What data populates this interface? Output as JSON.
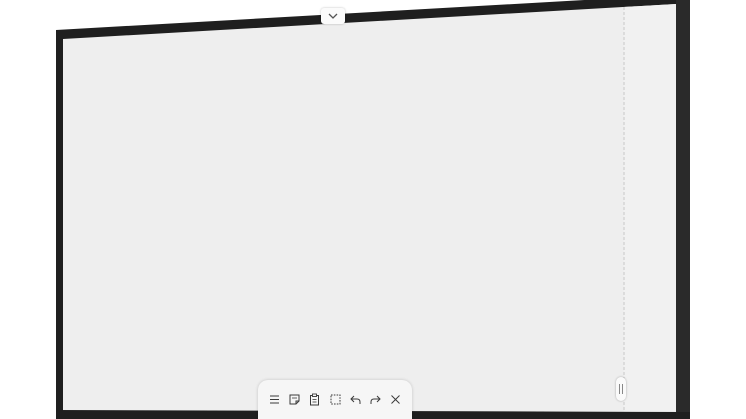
{
  "device": {
    "bezel_color": "#1f1f1f",
    "screen_color": "#eeeeee",
    "side_panel_color": "#f1f1f1",
    "divider_color": "#c8c8c8"
  },
  "top_handle": {
    "icon": "chevron-down-icon"
  },
  "toolbar": {
    "background": "#f6f6f6",
    "icon_color": "#3a3a3a",
    "tools": [
      {
        "icon": "menu-icon"
      },
      {
        "icon": "sticky-note-icon"
      },
      {
        "icon": "clipboard-icon"
      },
      {
        "icon": "selection-icon"
      },
      {
        "icon": "undo-icon"
      },
      {
        "icon": "redo-icon"
      },
      {
        "icon": "close-icon"
      }
    ]
  },
  "side_handle": {
    "icon": "grip-icon"
  }
}
